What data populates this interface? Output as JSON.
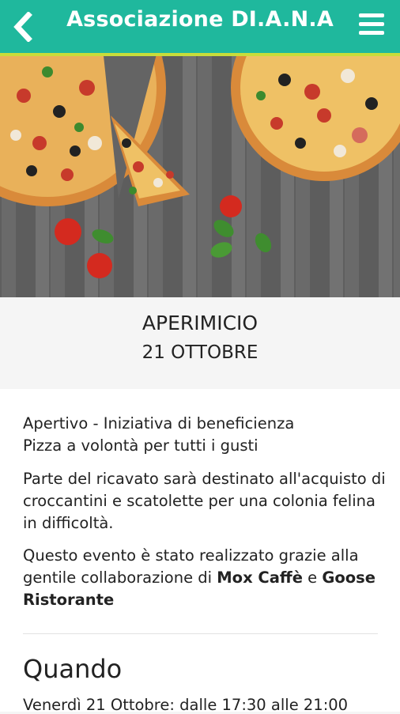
{
  "header": {
    "title": "Associazione DI.A.N.A",
    "back_icon": "chevron-left-icon",
    "menu_icon": "hamburger-menu-icon"
  },
  "colors": {
    "header_bg": "#1fb89d",
    "header_border": "#c8dd3a"
  },
  "event": {
    "title": "APERIMICIO",
    "date": "21 OTTOBRE"
  },
  "description": {
    "line1": "Apertivo - Iniziativa di beneficienza",
    "line2": "Pizza a volontà per tutti i gusti",
    "para2": "Parte del ricavato sarà destinato all'acquisto di croccantini e scatolette per una colonia felina in difficoltà.",
    "para3_prefix": "Questo evento è stato realizzato grazie alla gentile collaborazione di ",
    "partner1": "Mox Caffè",
    "para3_join": " e ",
    "partner2": "Goose Ristorante"
  },
  "when": {
    "title": "Quando",
    "text": "Venerdì 21 Ottobre: dalle 17:30 alle 21:00"
  }
}
